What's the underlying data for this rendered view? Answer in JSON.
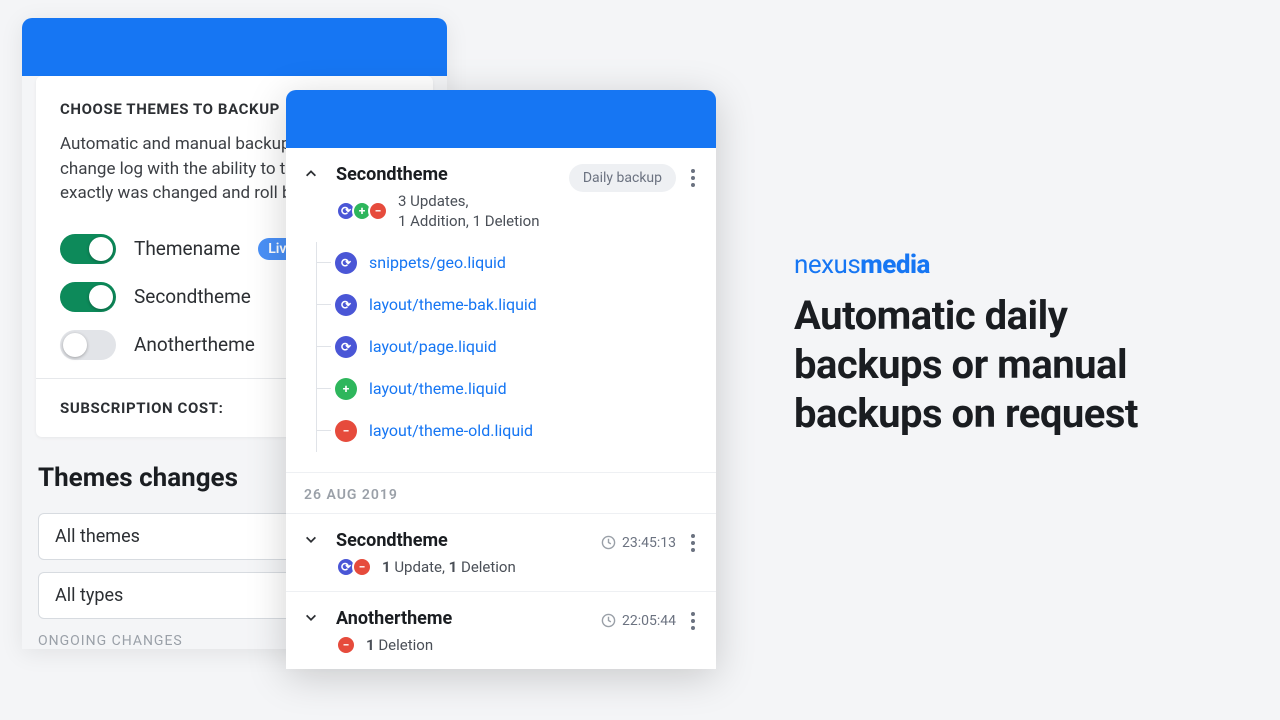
{
  "colors": {
    "brand": "#1676f3",
    "toggle_on": "#0d8a5a"
  },
  "left_panel": {
    "section_title": "CHOOSE THEMES TO BACKUP",
    "description": "Automatic and manual backup with full change log  with the ability to track what exactly was changed and roll back.",
    "themes": [
      {
        "name": "Themename",
        "enabled": true,
        "live_label": "Live"
      },
      {
        "name": "Secondtheme",
        "enabled": true,
        "live_label": ""
      },
      {
        "name": "Anothertheme",
        "enabled": false,
        "live_label": ""
      }
    ],
    "subscription_label": "SUBSCRIPTION COST:",
    "changes_heading": "Themes changes",
    "filter_theme": "All themes",
    "filter_type": "All types",
    "ongoing_label": "ONGOING CHANGES"
  },
  "detail": {
    "expanded": {
      "title": "Secondtheme",
      "chip": "Daily backup",
      "summary_line1": "3 Updates,",
      "summary_line2": "1 Addition, 1 Deletion",
      "files": [
        {
          "kind": "refresh",
          "path": "snippets/geo.liquid"
        },
        {
          "kind": "refresh",
          "path": "layout/theme-bak.liquid"
        },
        {
          "kind": "refresh",
          "path": "layout/page.liquid"
        },
        {
          "kind": "plus",
          "path": "layout/theme.liquid"
        },
        {
          "kind": "minus",
          "path": "layout/theme-old.liquid"
        }
      ]
    },
    "date_separator": "26 AUG 2019",
    "collapsed": [
      {
        "title": "Secondtheme",
        "time": "23:45:13",
        "summary_html": "<b>1</b> Update, <b>1</b> Deletion",
        "icons": [
          "refresh",
          "minus"
        ]
      },
      {
        "title": "Anothertheme",
        "time": "22:05:44",
        "summary_html": "<b>1</b> Deletion",
        "icons": [
          "minus"
        ]
      }
    ]
  },
  "copy": {
    "logo_thin": "nexus",
    "logo_bold": "media",
    "headline": "Automatic daily backups or manual backups on request"
  },
  "icons": {
    "refresh_glyph": "⟳",
    "plus_glyph": "+",
    "minus_glyph": "−"
  }
}
